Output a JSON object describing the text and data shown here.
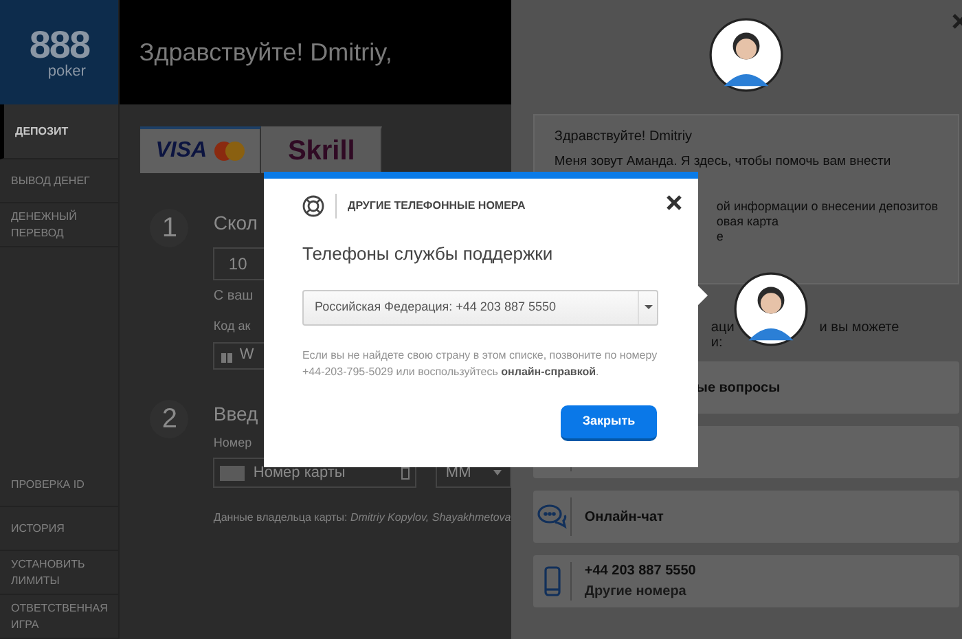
{
  "logo": {
    "digits": "888",
    "word": "poker"
  },
  "header": {
    "greeting": "Здравствуйте! Dmitriy,"
  },
  "nav": {
    "primary_items": [
      {
        "label": "ДЕПОЗИТ",
        "selected": true
      },
      {
        "label": "ВЫВОД ДЕНЕГ",
        "selected": false
      },
      {
        "label": "ДЕНЕЖНЫЙ ПЕРЕВОД",
        "selected": false
      }
    ],
    "secondary_items": [
      {
        "label": "ПРОВЕРКА ID",
        "selected": false
      },
      {
        "label": "ИСТОРИЯ",
        "selected": false
      },
      {
        "label": "УСТАНОВИТЬ ЛИМИТЫ",
        "selected": false
      },
      {
        "label": "ОТВЕТСТВЕННАЯ ИГРА",
        "selected": false
      }
    ]
  },
  "payment_methods": [
    {
      "kind": "visa",
      "label": "VISA",
      "selected": true
    },
    {
      "kind": "skrill",
      "label": "Skrill",
      "selected": false
    }
  ],
  "step_1": {
    "number": "1",
    "title": "Скол",
    "amount": "10",
    "note": "С ваш",
    "code_label": "Код ак",
    "code_value": "W"
  },
  "step_2": {
    "number": "2",
    "title": "Введ",
    "card_label": "Номер",
    "card_placeholder": "Номер карты",
    "month": "MM",
    "holder_label": "Данные владельца карты:",
    "holder_names": "Dmitriy Kopylov, Shayakhmetova"
  },
  "assistant": {
    "greeting": "Здравствуйте! Dmitriy",
    "intro": "Меня зовут Аманда. Я здесь, чтобы помочь вам внести",
    "fragments": [
      "ой информации о внесении депозитов",
      "овая карта",
      "е"
    ],
    "prompt_fragments": [
      "аци",
      "и вы можете",
      "и:"
    ]
  },
  "help_options": [
    {
      "kind": "faq",
      "title": "ые вопросы"
    },
    {
      "kind": "blank"
    },
    {
      "kind": "chat",
      "title": "Онлайн-чат"
    },
    {
      "kind": "phone",
      "title": "+44 203 887 5550",
      "subtitle": "Другие номера"
    }
  ],
  "modal": {
    "heading": "ДРУГИЕ ТЕЛЕФОННЫЕ НОМЕРА",
    "title": "Телефоны службы поддержки",
    "country_select": {
      "value": "Российская Федерация: +44 203 887 5550"
    },
    "note": "Если вы не найдете свою страну в этом списке, позвоните по номеру +44-203-795-5029 или воспользуйтесь",
    "note_link": "онлайн-справкой",
    "note_end": ".",
    "close_button": "Закрыть"
  }
}
